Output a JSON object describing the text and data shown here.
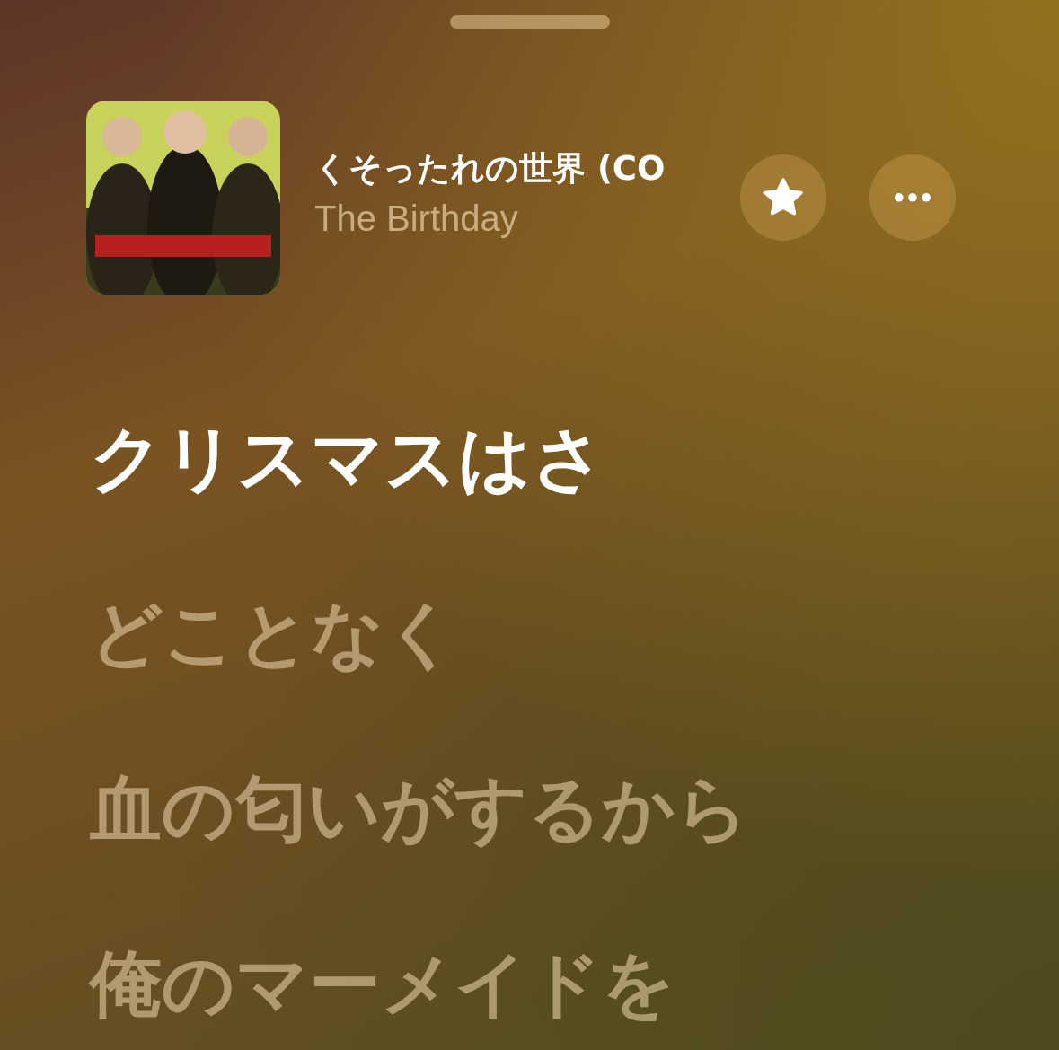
{
  "now_playing": {
    "title": "くそったれの世界 (CO",
    "artist": "The Birthday",
    "favorite": true
  },
  "lyrics": [
    {
      "text": "クリスマスはさ",
      "active": true
    },
    {
      "text": "どことなく",
      "active": false
    },
    {
      "text": "血の匂いがするから",
      "active": false
    },
    {
      "text": "俺のマーメイドを",
      "active": false
    }
  ]
}
